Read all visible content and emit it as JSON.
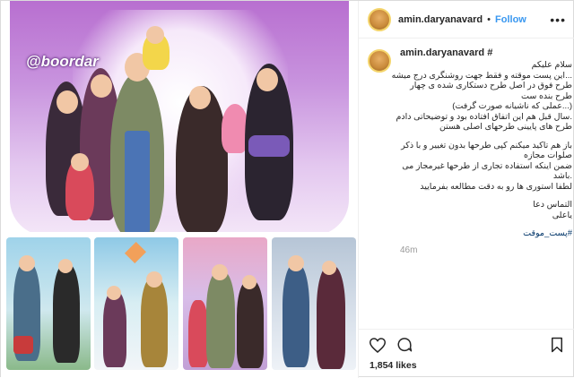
{
  "post": {
    "username": "amin.daryanavard",
    "separator": "•",
    "follow_label": "Follow",
    "more_icon": "more-options-icon",
    "watermark": "@boordar"
  },
  "caption": {
    "username": "amin.daryanavard #",
    "lines": [
      "سلام علیکم",
      "...این پست موقته و فقط جهت روشنگری درج میشه",
      "طرح فوق در اصل طرح دستکاری شده ی چهار",
      "طرح بنده ست",
      "(...عملی که ناشیانه صورت گرفت)",
      ".سال قبل هم این اتفاق افتاده بود و توضیحاتی دادم",
      "طرح های پایینی طرحهای اصلی هستن"
    ],
    "lines2": [
      "باز هم تاکید میکنم کپی طرحها بدون تغییر و با ذکر",
      "صلوات مجازه",
      "ضمن اینکه استفاده تجاری از طرحها غیرمجاز می",
      ".باشد",
      "لطفا استوری ها رو به دقت مطالعه بفرمایید"
    ],
    "lines3": [
      "التماس دعا",
      "یاعلی"
    ],
    "hashtag": "#پست_موقت",
    "time": "46m"
  },
  "actions": {
    "likes": "1,854 likes"
  },
  "colors": {
    "link": "#3897f0",
    "text": "#262626",
    "muted": "#999999",
    "border": "#efefef"
  }
}
